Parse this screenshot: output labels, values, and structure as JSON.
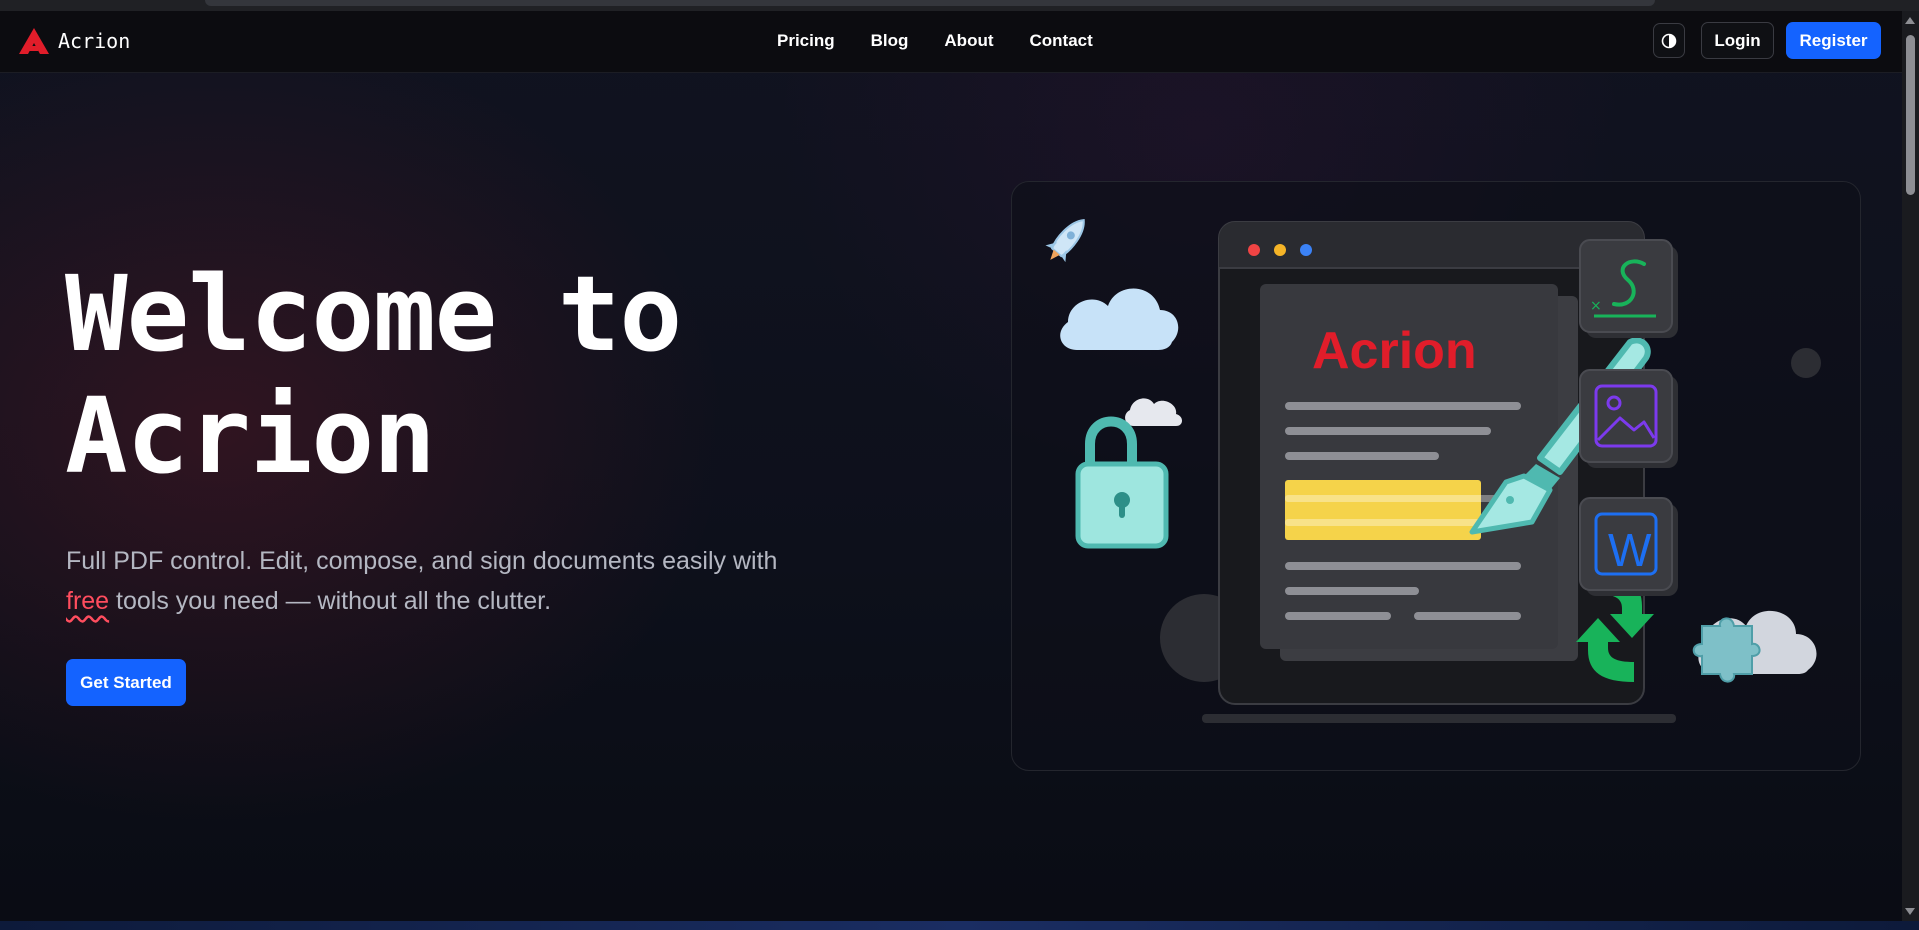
{
  "brand": {
    "name": "Acrion",
    "accent": "#e11d2a"
  },
  "nav": {
    "links": [
      "Pricing",
      "Blog",
      "About",
      "Contact"
    ],
    "theme_icon": "contrast-icon",
    "login_label": "Login",
    "register_label": "Register"
  },
  "hero": {
    "title_line1": "Welcome to",
    "title_line2": "Acrion",
    "subtitle_part1": "Full PDF control. Edit, compose, and sign documents easily with",
    "subtitle_highlight": "free",
    "subtitle_part2": " tools you need — without all the clutter.",
    "cta_label": "Get Started"
  },
  "illustration": {
    "doc_logo": "Acrion",
    "tool_icons": [
      "signature-icon",
      "image-icon",
      "word-icon"
    ],
    "side_icons": [
      "rocket-icon",
      "cloud-icon",
      "lock-icon",
      "sync-icon",
      "puzzle-icon"
    ],
    "word_letter": "W",
    "colors": {
      "teal": "#7fd9d4",
      "highlight": "#f5d34a",
      "green": "#18b35a",
      "blue": "#1d6ff2",
      "purple": "#7c3aed"
    }
  },
  "theme": {
    "primary": "#1463ff"
  }
}
